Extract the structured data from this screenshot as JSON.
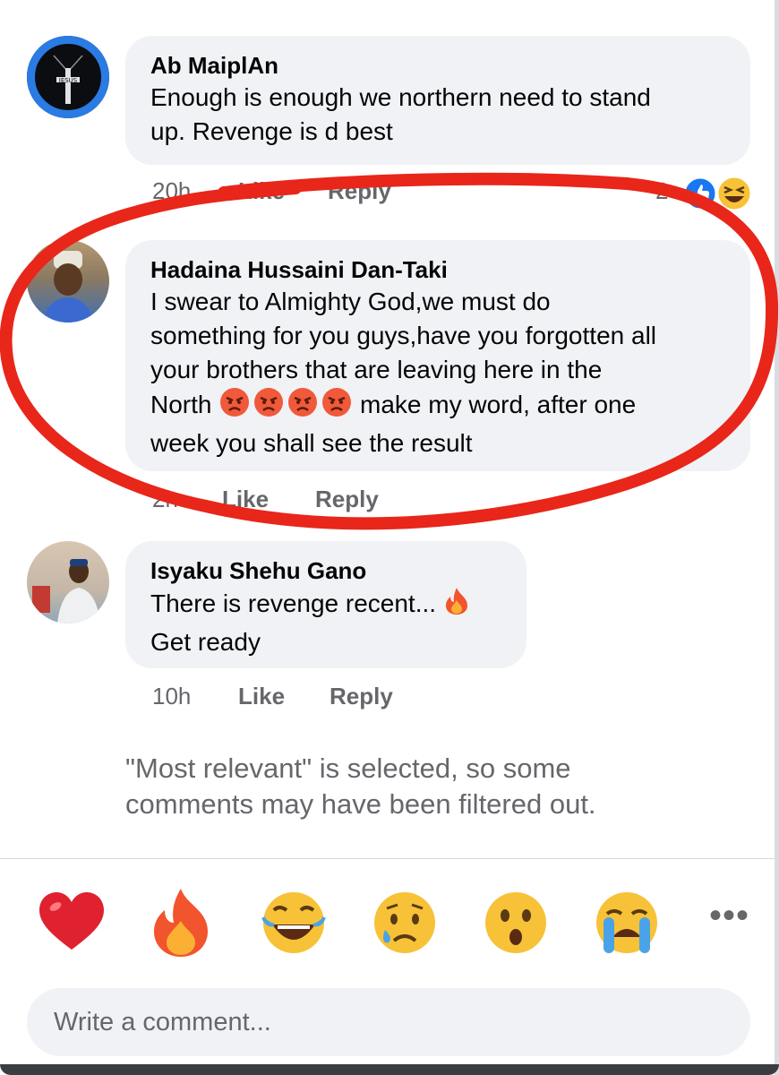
{
  "comments": [
    {
      "author": "Ab MaiplAn",
      "lines": [
        "Enough is enough we northern need to stand",
        "up. Revenge is d best"
      ],
      "time": "20h",
      "like_label": "Like",
      "reply_label": "Reply",
      "reaction_count": "2"
    },
    {
      "author": "Hadaina Hussaini Dan-Taki",
      "lines": [
        "I swear to Almighty God,we must do",
        "something for you guys,have you forgotten all",
        "your brothers that are leaving here in the"
      ],
      "line4_before": "North",
      "line4_after": "make my word, after one",
      "line5": "week you shall see the result",
      "time": "2h",
      "like_label": "Like",
      "reply_label": "Reply"
    },
    {
      "author": "Isyaku Shehu Gano",
      "line1": "There is revenge recent...",
      "line2": "Get ready",
      "time": "10h",
      "like_label": "Like",
      "reply_label": "Reply"
    }
  ],
  "avatar_badge_text": "JESUS",
  "filter_notice": "\"Most relevant\" is selected, so some comments may have been filtered out.",
  "quick_reactions": [
    "heart",
    "fire",
    "laughing",
    "sad-tear",
    "surprised",
    "crying"
  ],
  "comment_input": {
    "placeholder": "Write a comment..."
  },
  "colors": {
    "bubble": "#f0f2f5",
    "meta_text": "#65676b",
    "like_blue": "#1877f2",
    "annotation_red": "#e8261a"
  }
}
